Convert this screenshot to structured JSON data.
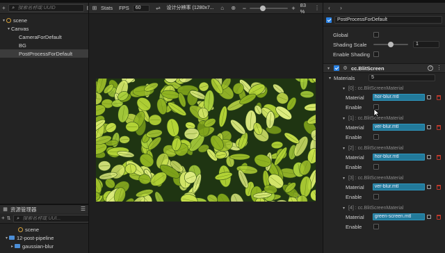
{
  "scene_toolbar": {
    "stats_label": "Stats",
    "fps_label": "FPS",
    "fps_value": "60",
    "resolution_label": "设计分辨率 (1280x7...",
    "zoom_minus": "−",
    "zoom_plus": "+",
    "zoom_value": "83 %",
    "zoom_level": 0.35
  },
  "hierarchy": {
    "search_placeholder": "搜索名称或 UUID",
    "items": [
      {
        "label": "scene"
      },
      {
        "label": "Canvas"
      },
      {
        "label": "CameraForDefault"
      },
      {
        "label": "BG"
      },
      {
        "label": "PostProcessForDefault"
      }
    ]
  },
  "assets": {
    "title": "资源管理器",
    "search_placeholder": "搜索名称或 UUI...",
    "items": [
      {
        "label": "scene"
      },
      {
        "label": "12-post-pipeline"
      },
      {
        "label": "gaussian-blur"
      }
    ]
  },
  "inspector": {
    "node_name": "PostProcessForDefault",
    "props": {
      "global_label": "Global",
      "shading_scale_label": "Shading Scale",
      "shading_scale_value": "1",
      "shading_scale_level": 0.5,
      "enable_shading_label": "Enable Shading"
    },
    "component": {
      "name": "cc.BlitScreen",
      "materials_label": "Materials",
      "materials_count": "5",
      "materials": [
        {
          "header": "[0] : cc.BlitScreenMaterial",
          "material_label": "Material",
          "material_value": "hor-blur.mtl",
          "enable_label": "Enable"
        },
        {
          "header": "[1] : cc.BlitScreenMaterial",
          "material_label": "Material",
          "material_value": "ver-blur.mtl",
          "enable_label": "Enable"
        },
        {
          "header": "[2] : cc.BlitScreenMaterial",
          "material_label": "Material",
          "material_value": "hor-blur.mtl",
          "enable_label": "Enable"
        },
        {
          "header": "[3] : cc.BlitScreenMaterial",
          "material_label": "Material",
          "material_value": "ver-blur.mtl",
          "enable_label": "Enable"
        },
        {
          "header": "[4] : cc.BlitScreenMaterial",
          "material_label": "Material",
          "material_value": "green-screen.mtl",
          "enable_label": "Enable"
        }
      ]
    }
  },
  "colors": {
    "accent": "#2a82e4",
    "material_field": "#227a9b",
    "scene_icon": "#d7a23a",
    "folder": "#4c8ed6",
    "delete": "#c0392b"
  }
}
